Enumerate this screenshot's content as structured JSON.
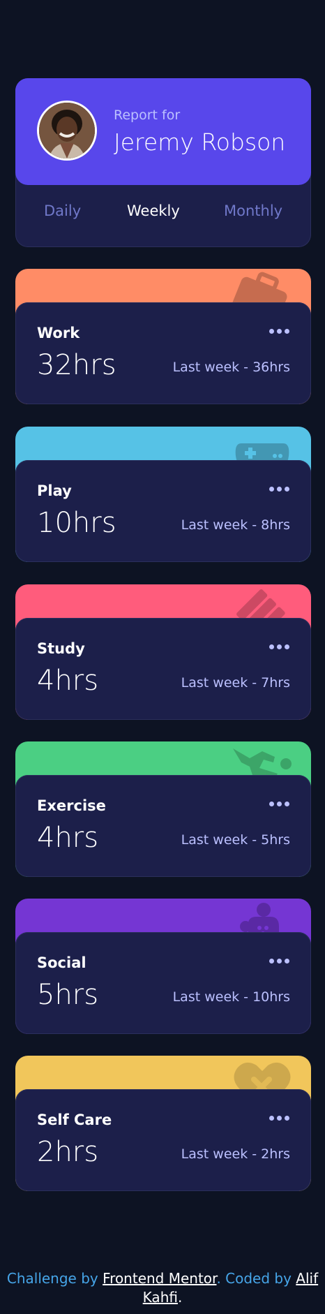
{
  "profile": {
    "report_for": "Report for",
    "name": "Jeremy Robson",
    "avatar_alt": "avatar"
  },
  "periods": [
    {
      "label": "Daily",
      "active": false
    },
    {
      "label": "Weekly",
      "active": true
    },
    {
      "label": "Monthly",
      "active": false
    }
  ],
  "cards": [
    {
      "title": "Work",
      "hours": "32hrs",
      "previous": "Last week - 36hrs",
      "color": "#ff8c66",
      "icon": "briefcase-icon"
    },
    {
      "title": "Play",
      "hours": "10hrs",
      "previous": "Last week - 8hrs",
      "color": "#56c2e6",
      "icon": "gamepad-icon"
    },
    {
      "title": "Study",
      "hours": "4hrs",
      "previous": "Last week - 7hrs",
      "color": "#ff5c7c",
      "icon": "book-icon"
    },
    {
      "title": "Exercise",
      "hours": "4hrs",
      "previous": "Last week - 5hrs",
      "color": "#4bcf83",
      "icon": "running-person-icon"
    },
    {
      "title": "Social",
      "hours": "5hrs",
      "previous": "Last week - 10hrs",
      "color": "#7536d3",
      "icon": "people-icon"
    },
    {
      "title": "Self Care",
      "hours": "2hrs",
      "previous": "Last week - 2hrs",
      "color": "#f1c65b",
      "icon": "heart-icon"
    }
  ],
  "footer": {
    "prefix": "Challenge by",
    "link1": "Frontend Mentor",
    "middle": ". Coded by",
    "link2": "Alif Kahfi",
    "suffix": "."
  }
}
